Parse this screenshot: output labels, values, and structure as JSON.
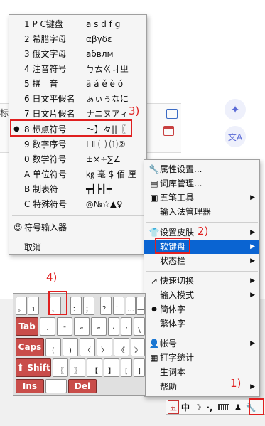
{
  "background": {
    "partial_text": "标",
    "sparkle_icon": "✦",
    "translate_icon": "文A"
  },
  "softkbd_menu": {
    "items": [
      {
        "label": "1 P C键盘",
        "symbols": "a s d f g"
      },
      {
        "label": "2 希腊字母",
        "symbols": "αβγδε"
      },
      {
        "label": "3 俄文字母",
        "symbols": "абвлм"
      },
      {
        "label": "4 注音符号",
        "symbols": "ㄅㄊㄍㄐㄓ"
      },
      {
        "label": "5 拼　音",
        "symbols": "ā á ě è ó"
      },
      {
        "label": "6 日文平假名",
        "symbols": "ぁぃぅなに"
      },
      {
        "label": "7 日文片假名",
        "symbols": "ナニヌアィ"
      },
      {
        "label": "8 标点符号",
        "symbols": "～】々||〖"
      },
      {
        "label": "9 数字序号",
        "symbols": "Ⅰ Ⅱ ㈠ ⑴②"
      },
      {
        "label": "0 数学符号",
        "symbols": "±×÷∑∠"
      },
      {
        "label": "A 单位符号",
        "symbols": "㎏ 毫 $ 佰 厘"
      },
      {
        "label": "B 制表符",
        "symbols": "┯┫┣┃┿"
      },
      {
        "label": "C 特殊符号",
        "symbols": "◎№☆▲♀"
      }
    ],
    "selected": "8 标点符号",
    "symbol_input": "符号输入器",
    "cancel": "取消"
  },
  "context_menu": {
    "items": [
      "属性设置...",
      "词库管理...",
      "五笔工具",
      "输入法管理器",
      "设置皮肤",
      "软键盘",
      "状态栏",
      "快速切换",
      "输入模式",
      "简体字",
      "繁体字",
      "帐号",
      "打字统计",
      "生词本",
      "帮助"
    ],
    "highlighted": "软键盘"
  },
  "annotations": {
    "step1": "1)",
    "step2": "2)",
    "step3": "3)",
    "step4": "4)"
  },
  "soft_keyboard": {
    "row1": [
      {
        "top": "",
        "bottom": "。"
      },
      {
        "top": "",
        "bottom": "1"
      },
      {
        "top": "",
        "bottom": "、"
      },
      {
        "top": "",
        "bottom": "："
      },
      {
        "top": "",
        "bottom": "；"
      },
      {
        "top": "",
        "bottom": "？"
      },
      {
        "top": "",
        "bottom": "！"
      },
      {
        "top": "",
        "bottom": "…"
      },
      {
        "top": "",
        "bottom": "—"
      }
    ],
    "row2": [
      {
        "top": "",
        "bottom": "·"
      },
      {
        "top": "",
        "bottom": "ˉ"
      },
      {
        "top": "",
        "bottom": "“"
      },
      {
        "top": "",
        "bottom": "”"
      },
      {
        "top": "",
        "bottom": "‘"
      },
      {
        "top": "",
        "bottom": "’"
      },
      {
        "top": "",
        "bottom": "\\"
      }
    ],
    "row3": [
      {
        "top": "",
        "bottom": "("
      },
      {
        "top": "",
        "bottom": ")"
      },
      {
        "top": "",
        "bottom": "〈"
      },
      {
        "top": "",
        "bottom": "〉"
      },
      {
        "top": "",
        "bottom": "《"
      },
      {
        "top": "",
        "bottom": "》"
      }
    ],
    "row4": [
      {
        "top": "",
        "bottom": "〖"
      },
      {
        "top": "",
        "bottom": "〗"
      },
      {
        "top": "",
        "bottom": "【"
      },
      {
        "top": "",
        "bottom": "】"
      },
      {
        "top": "",
        "bottom": "["
      },
      {
        "top": "",
        "bottom": "]"
      }
    ],
    "tab": "Tab",
    "caps": "Caps",
    "shift": "Shift",
    "ins": "Ins",
    "del": "Del"
  },
  "status_bar": {
    "mode": "五",
    "lang": "中",
    "moon": "☽",
    "dot": "·,"
  },
  "colors": {
    "highlight": "#0a64d2",
    "annotation": "#e02020",
    "function_key": "#c94d4a"
  }
}
